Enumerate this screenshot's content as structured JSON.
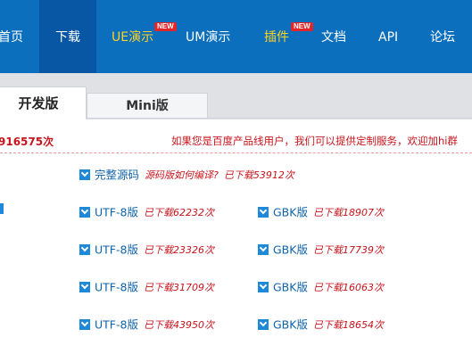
{
  "nav": {
    "items": [
      {
        "label": "首页"
      },
      {
        "label": "下载"
      },
      {
        "label": "UE演示"
      },
      {
        "label": "UM演示"
      },
      {
        "label": "插件"
      },
      {
        "label": "文档"
      },
      {
        "label": "API"
      },
      {
        "label": "论坛"
      }
    ],
    "badge": "NEW",
    "colors": {
      "bar": "#0b6fbd",
      "active": "#0857a5",
      "highlight": "#ffd323",
      "badge": "#e0262b"
    }
  },
  "tabs": [
    {
      "label": "开发版"
    },
    {
      "label": "Mini版"
    }
  ],
  "info": {
    "total_downloads": "916575次",
    "notice": "如果您是百度产品线用户，我们可以提供定制服务，欢迎加hi群"
  },
  "source": {
    "label": "完整源码",
    "note": "源码版如何编译?",
    "count": "已下载53912次"
  },
  "downloads": [
    {
      "utf8_label": "UTF-8版",
      "utf8_count": "已下载62232次",
      "gbk_label": "GBK版",
      "gbk_count": "已下载18907次"
    },
    {
      "utf8_label": "UTF-8版",
      "utf8_count": "已下载23326次",
      "gbk_label": "GBK版",
      "gbk_count": "已下载17739次"
    },
    {
      "utf8_label": "UTF-8版",
      "utf8_count": "已下载31709次",
      "gbk_label": "GBK版",
      "gbk_count": "已下载16063次"
    },
    {
      "utf8_label": "UTF-8版",
      "utf8_count": "已下载43950次",
      "gbk_label": "GBK版",
      "gbk_count": "已下载18654次"
    }
  ]
}
